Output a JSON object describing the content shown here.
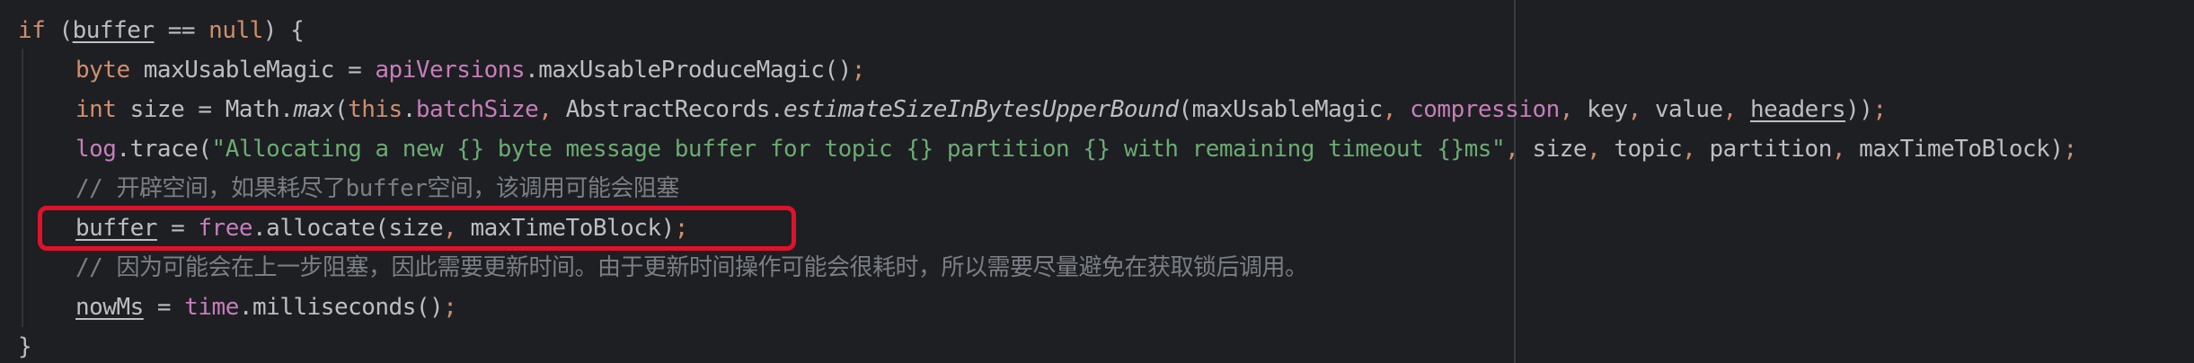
{
  "editor": {
    "lines": [
      {
        "indent": 0,
        "tokens": [
          {
            "t": "if",
            "c": "k"
          },
          {
            "t": " ("
          },
          {
            "t": "buffer",
            "c": "u"
          },
          {
            "t": " == "
          },
          {
            "t": "null",
            "c": "k"
          },
          {
            "t": ") {"
          }
        ]
      },
      {
        "indent": 1,
        "tokens": [
          {
            "t": "byte",
            "c": "k"
          },
          {
            "t": " maxUsableMagic = "
          },
          {
            "t": "apiVersions",
            "c": "f"
          },
          {
            "t": ".maxUsableProduceMagic()"
          },
          {
            "t": ";",
            "c": "k"
          }
        ]
      },
      {
        "indent": 1,
        "tokens": [
          {
            "t": "int",
            "c": "k"
          },
          {
            "t": " size = Math."
          },
          {
            "t": "max",
            "c": "i"
          },
          {
            "t": "("
          },
          {
            "t": "this",
            "c": "k"
          },
          {
            "t": "."
          },
          {
            "t": "batchSize",
            "c": "f"
          },
          {
            "t": ", ",
            "c": "k"
          },
          {
            "t": "AbstractRecords."
          },
          {
            "t": "estimateSizeInBytesUpperBound",
            "c": "i"
          },
          {
            "t": "(maxUsableMagic"
          },
          {
            "t": ", ",
            "c": "k"
          },
          {
            "t": "compression",
            "c": "f"
          },
          {
            "t": ", ",
            "c": "k"
          },
          {
            "t": "key"
          },
          {
            "t": ", ",
            "c": "k"
          },
          {
            "t": "value"
          },
          {
            "t": ", ",
            "c": "k"
          },
          {
            "t": "headers",
            "c": "u"
          },
          {
            "t": "))"
          },
          {
            "t": ";",
            "c": "k"
          }
        ]
      },
      {
        "indent": 1,
        "tokens": [
          {
            "t": "log",
            "c": "f"
          },
          {
            "t": ".trace("
          },
          {
            "t": "\"Allocating a new {} byte message buffer for topic {} partition {} with remaining timeout {}ms\"",
            "c": "s"
          },
          {
            "t": ", ",
            "c": "k"
          },
          {
            "t": "size"
          },
          {
            "t": ", ",
            "c": "k"
          },
          {
            "t": "topic"
          },
          {
            "t": ", ",
            "c": "k"
          },
          {
            "t": "partition"
          },
          {
            "t": ", ",
            "c": "k"
          },
          {
            "t": "maxTimeToBlock)"
          },
          {
            "t": ";",
            "c": "k"
          }
        ]
      },
      {
        "indent": 1,
        "tokens": [
          {
            "t": "// 开辟空间，如果耗尽了buffer空间，该调用可能会阻塞",
            "c": "c"
          }
        ]
      },
      {
        "indent": 1,
        "tokens": [
          {
            "t": "buffer",
            "c": "u"
          },
          {
            "t": " = "
          },
          {
            "t": "free",
            "c": "f"
          },
          {
            "t": ".allocate(size"
          },
          {
            "t": ", ",
            "c": "k"
          },
          {
            "t": "maxTimeToBlock)"
          },
          {
            "t": ";",
            "c": "k"
          }
        ]
      },
      {
        "indent": 1,
        "tokens": [
          {
            "t": "// 因为可能会在上一步阻塞，因此需要更新时间。由于更新时间操作可能会很耗时，所以需要尽量避免在获取锁后调用。",
            "c": "c"
          }
        ]
      },
      {
        "indent": 1,
        "tokens": [
          {
            "t": "nowMs",
            "c": "u"
          },
          {
            "t": " = "
          },
          {
            "t": "time",
            "c": "f"
          },
          {
            "t": ".milliseconds()"
          },
          {
            "t": ";",
            "c": "k"
          }
        ]
      },
      {
        "indent": 0,
        "tokens": [
          {
            "t": "}"
          }
        ]
      }
    ]
  },
  "colors": {
    "background": "#1e1f22",
    "keyword": "#cf8e6d",
    "field": "#c77dbb",
    "string": "#6aab73",
    "comment": "#7a7e85",
    "text": "#bcbec4",
    "highlight_box": "#e0122b"
  }
}
